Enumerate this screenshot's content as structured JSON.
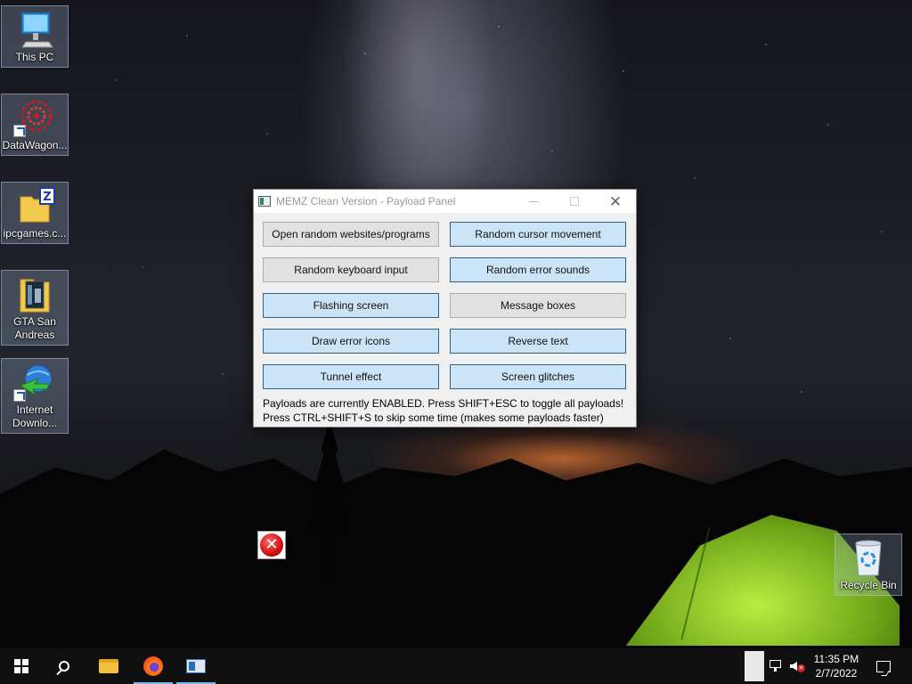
{
  "desktop": {
    "icons": [
      {
        "label": "This PC",
        "icon": "this-pc-icon"
      },
      {
        "label": "DataWagon...",
        "icon": "datawagon-icon"
      },
      {
        "label": "ipcgames.c...",
        "icon": "zip-folder-icon"
      },
      {
        "label": "GTA San Andreas",
        "icon": "gta-folder-icon"
      },
      {
        "label": "Internet Downlo...",
        "icon": "internet-download-manager-icon"
      },
      {
        "label": "Recycle Bin",
        "icon": "recycle-bin-icon"
      }
    ]
  },
  "window": {
    "title": "MEMZ Clean Version - Payload Panel",
    "payloads": [
      {
        "label": "Open random websites/programs",
        "enabled": false
      },
      {
        "label": "Random cursor movement",
        "enabled": true
      },
      {
        "label": "Random keyboard input",
        "enabled": false
      },
      {
        "label": "Random error sounds",
        "enabled": true
      },
      {
        "label": "Flashing screen",
        "enabled": true
      },
      {
        "label": "Message boxes",
        "enabled": false
      },
      {
        "label": "Draw error icons",
        "enabled": true
      },
      {
        "label": "Reverse text",
        "enabled": true
      },
      {
        "label": "Tunnel effect",
        "enabled": true
      },
      {
        "label": "Screen glitches",
        "enabled": true
      }
    ],
    "status_line1": "Payloads are currently ENABLED. Press SHIFT+ESC to toggle all payloads!",
    "status_line2": "Press CTRL+SHIFT+S to skip some time (makes some payloads faster)"
  },
  "taskbar": {
    "items": [
      "start-icon",
      "search-icon",
      "file-explorer-icon",
      "firefox-icon",
      "memz-app-icon"
    ],
    "clock_time": "11:35 PM",
    "clock_date": "2/7/2022"
  },
  "colors": {
    "button_on_bg": "#cce4f7",
    "button_on_border": "#2c628b",
    "button_off_bg": "#e1e1e1",
    "taskbar_bg": "#101010",
    "active_indicator": "#76b9ed"
  }
}
